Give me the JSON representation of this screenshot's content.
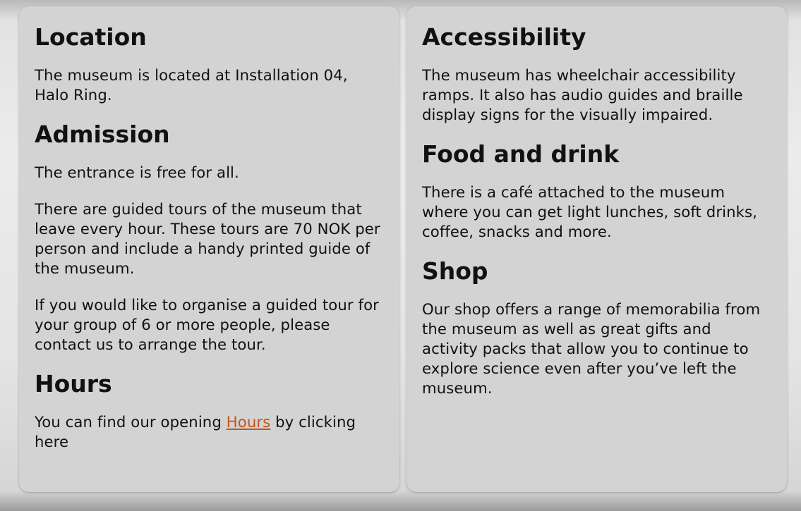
{
  "left_panel": {
    "location": {
      "heading": "Location",
      "text": "The museum is located at Installation 04, Halo Ring."
    },
    "admission": {
      "heading": "Admission",
      "text_1": "The entrance is free for all.",
      "text_2": "There are guided tours of the museum that leave every hour. These tours are 70 NOK per person and include a handy printed guide of the museum.",
      "text_3": "If you would like to organise a guided tour for your group of 6 or more people, please contact us to arrange the tour."
    },
    "hours": {
      "heading": "Hours",
      "text_before": "You can find our opening ",
      "link_label": "Hours",
      "text_after": " by clicking here"
    }
  },
  "right_panel": {
    "accessibility": {
      "heading": "Accessibility",
      "text": "The museum has wheelchair accessibility ramps. It also has audio guides and braille display signs for the visually impaired."
    },
    "food": {
      "heading": "Food and drink",
      "text": "There is a café attached to the museum where you can get light lunches, soft drinks, coffee, snacks and more."
    },
    "shop": {
      "heading": "Shop",
      "text": "Our shop offers a range of memorabilia from the museum as well as great gifts and activity packs that allow you to continue to explore science even after you’ve left the museum."
    }
  },
  "colors": {
    "panel_background": "#d3d3d3",
    "text": "#111111",
    "link": "#c0561e"
  }
}
